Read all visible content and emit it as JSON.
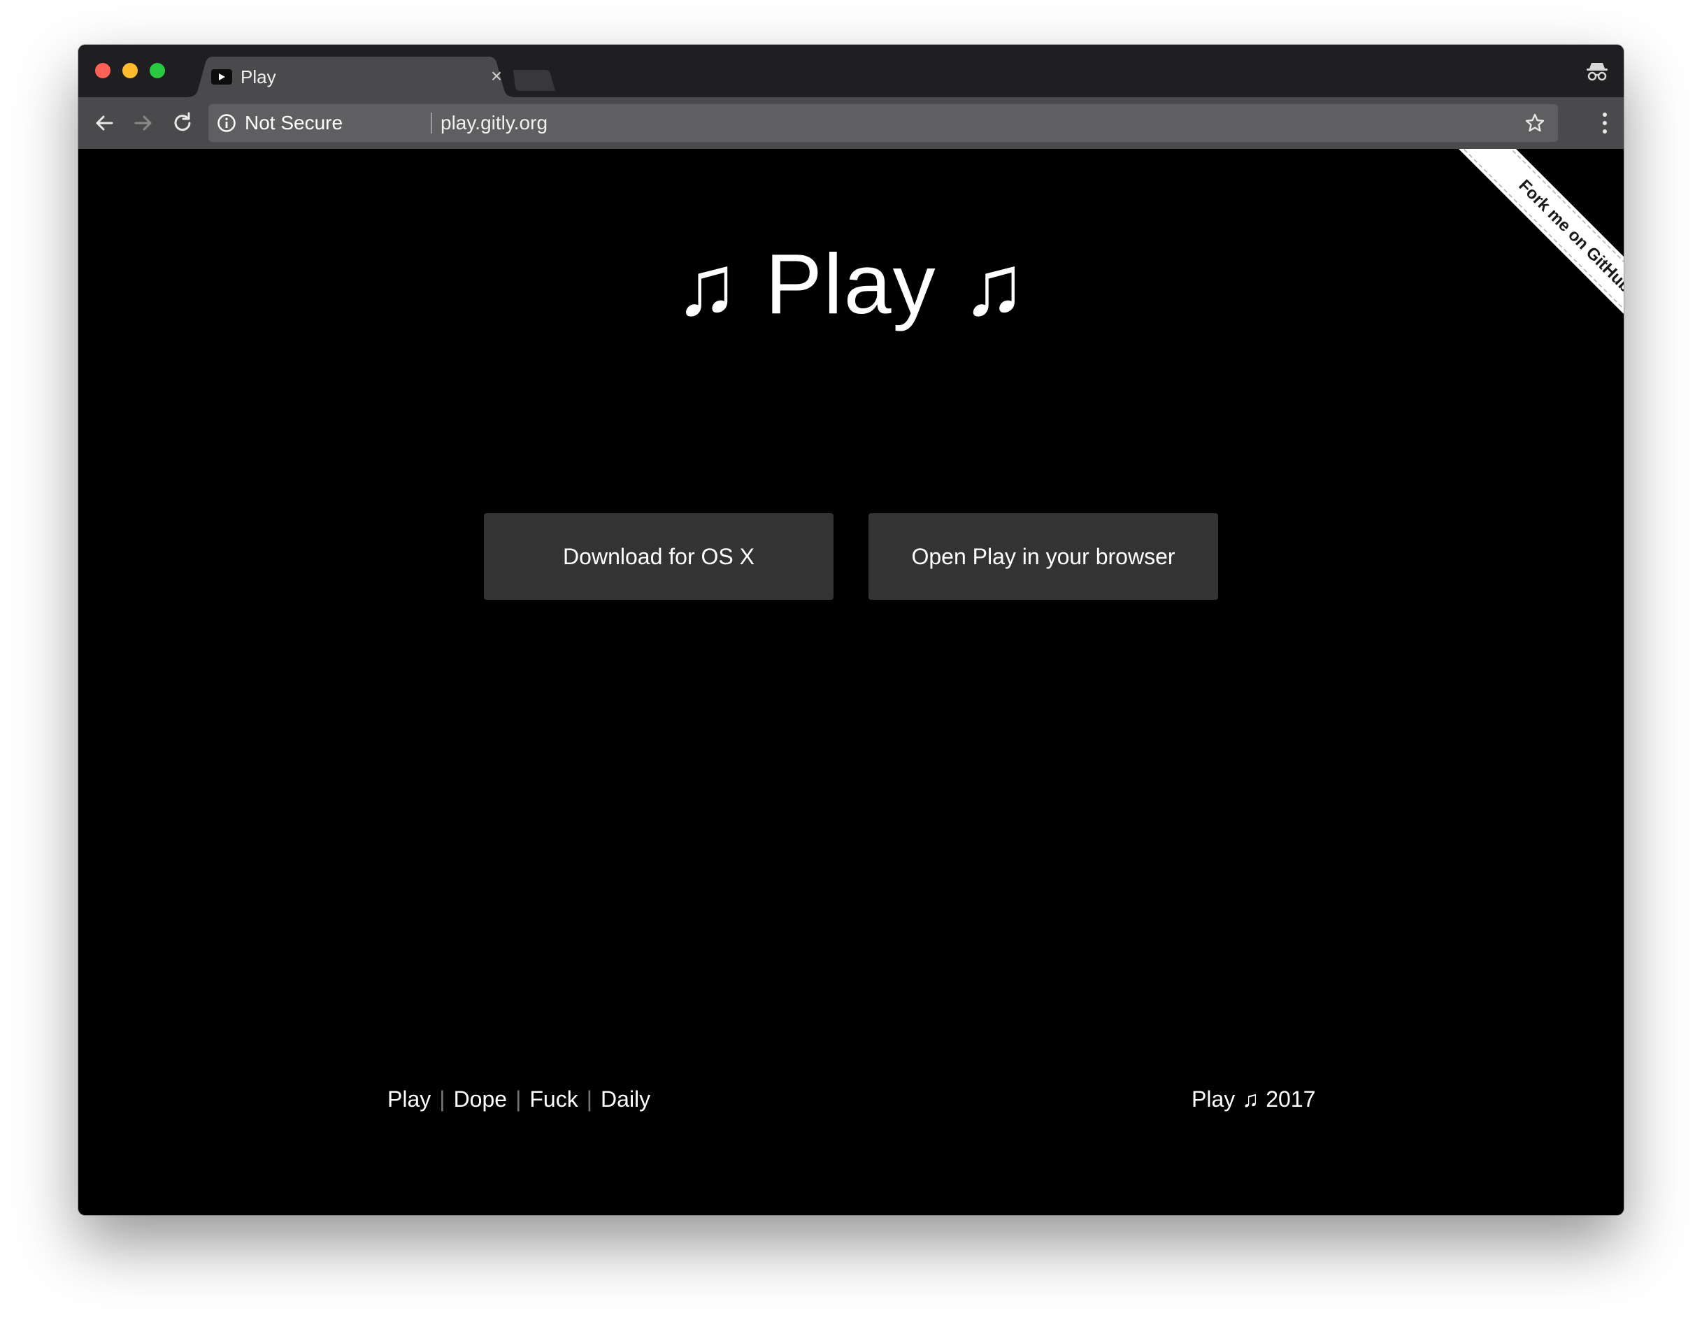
{
  "browser": {
    "tab": {
      "title": "Play",
      "close_glyph": "×",
      "favicon_icon": "play-favicon-icon"
    },
    "new_tab_icon": "new-tab-icon",
    "incognito_icon": "incognito-icon",
    "toolbar": {
      "back_icon": "arrow-left-icon",
      "forward_icon": "arrow-right-icon",
      "reload_icon": "reload-icon",
      "menu_icon": "kebab-menu-icon"
    },
    "omnibox": {
      "security_label": "Not Secure",
      "url": "play.gitly.org",
      "info_icon": "info-icon",
      "bookmark_icon": "star-icon"
    }
  },
  "page": {
    "hero": {
      "note_left": "♫",
      "title": "Play",
      "note_right": "♫"
    },
    "buttons": {
      "download_label": "Download for OS X",
      "open_label": "Open Play in your browser"
    },
    "ribbon": {
      "label": "Fork me on GitHub"
    },
    "footer": {
      "links": [
        "Play",
        "Dope",
        "Fuck",
        "Daily"
      ],
      "separator": "|",
      "credit_name": "Play",
      "credit_note": "♫",
      "credit_year": "2017"
    }
  },
  "colors": {
    "tabstrip_bg": "#1f1f21",
    "toolbar_bg": "#4a4a4c",
    "omnibox_bg": "#5f5f61",
    "page_bg": "#000000",
    "button_bg": "#333333",
    "text": "#ffffff"
  }
}
